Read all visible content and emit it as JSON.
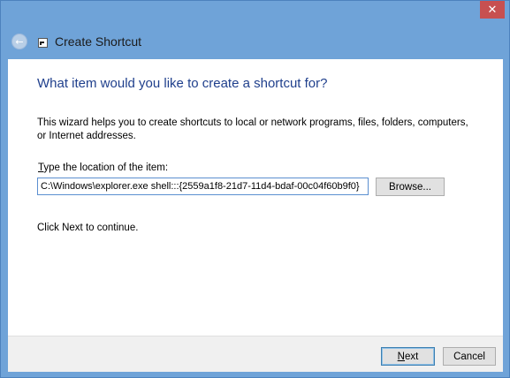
{
  "window": {
    "title": "Create Shortcut",
    "close_glyph": "✕"
  },
  "titlebar": {
    "back_icon": "back-arrow-icon",
    "app_icon": "shortcut-icon"
  },
  "main": {
    "heading": "What item would you like to create a shortcut for?",
    "description": "This wizard helps you to create shortcuts to local or network programs, files, folders, computers, or Internet addresses.",
    "location_label_mnemonic": "T",
    "location_label_rest": "ype the location of the item:",
    "location_value": "C:\\Windows\\explorer.exe shell:::{2559a1f8-21d7-11d4-bdaf-00c04f60b9f0}",
    "browse_label_mnemonic": "R",
    "browse_label": "Browse...",
    "continue_text": "Click Next to continue."
  },
  "footer": {
    "next_mnemonic": "N",
    "next_rest": "ext",
    "cancel_label": "Cancel"
  },
  "colors": {
    "frame": "#6fa3d8",
    "close": "#c75050",
    "heading": "#1f3f8c",
    "input_border": "#5b8fd0"
  }
}
